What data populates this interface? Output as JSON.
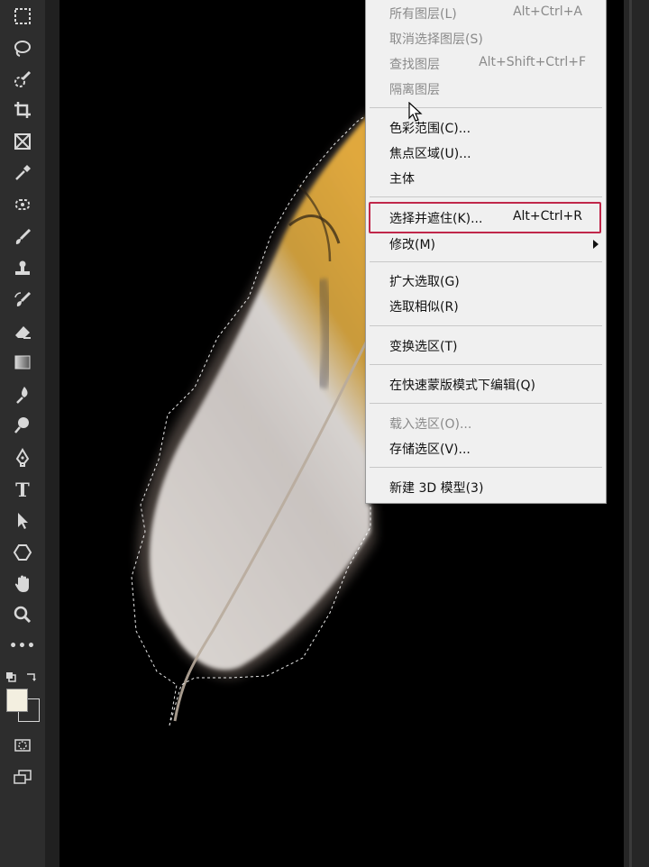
{
  "toolbar": {
    "tools": [
      "marquee-tool",
      "lasso-tool",
      "quick-selection-tool",
      "crop-tool",
      "frame-tool",
      "eyedropper-tool",
      "healing-brush-tool",
      "brush-tool",
      "clone-stamp-tool",
      "history-brush-tool",
      "eraser-tool",
      "gradient-tool",
      "blur-tool",
      "dodge-tool",
      "pen-tool",
      "type-tool",
      "path-selection-tool",
      "shape-tool",
      "hand-tool",
      "zoom-tool",
      "more-tools",
      "quick-mask-mode",
      "screen-mode"
    ],
    "type_glyph": "T",
    "more_glyph": "•••",
    "foreground_color": "#f3efe0",
    "background_color": "#2d2d2d"
  },
  "menu": {
    "items": [
      {
        "label": "所有图层(L)",
        "shortcut": "Alt+Ctrl+A",
        "disabled": true
      },
      {
        "label": "取消选择图层(S)",
        "shortcut": "",
        "disabled": true
      },
      {
        "label": "查找图层",
        "shortcut": "Alt+Shift+Ctrl+F",
        "disabled": true
      },
      {
        "label": "隔离图层",
        "shortcut": "",
        "disabled": true
      },
      {
        "label": "色彩范围(C)...",
        "shortcut": "",
        "disabled": false
      },
      {
        "label": "焦点区域(U)...",
        "shortcut": "",
        "disabled": false
      },
      {
        "label": "主体",
        "shortcut": "",
        "disabled": false
      },
      {
        "label": "选择并遮住(K)...",
        "shortcut": "Alt+Ctrl+R",
        "disabled": false,
        "highlighted": true
      },
      {
        "label": "修改(M)",
        "shortcut": "",
        "disabled": false,
        "submenu": true
      },
      {
        "label": "扩大选取(G)",
        "shortcut": "",
        "disabled": false
      },
      {
        "label": "选取相似(R)",
        "shortcut": "",
        "disabled": false
      },
      {
        "label": "变换选区(T)",
        "shortcut": "",
        "disabled": false
      },
      {
        "label": "在快速蒙版模式下编辑(Q)",
        "shortcut": "",
        "disabled": false
      },
      {
        "label": "载入选区(O)...",
        "shortcut": "",
        "disabled": true
      },
      {
        "label": "存储选区(V)...",
        "shortcut": "",
        "disabled": false
      },
      {
        "label": "新建 3D 模型(3)",
        "shortcut": "",
        "disabled": false
      }
    ],
    "highlight_color": "#c0274a"
  },
  "canvas": {
    "background": "#000000",
    "content": "feather-with-selection"
  }
}
